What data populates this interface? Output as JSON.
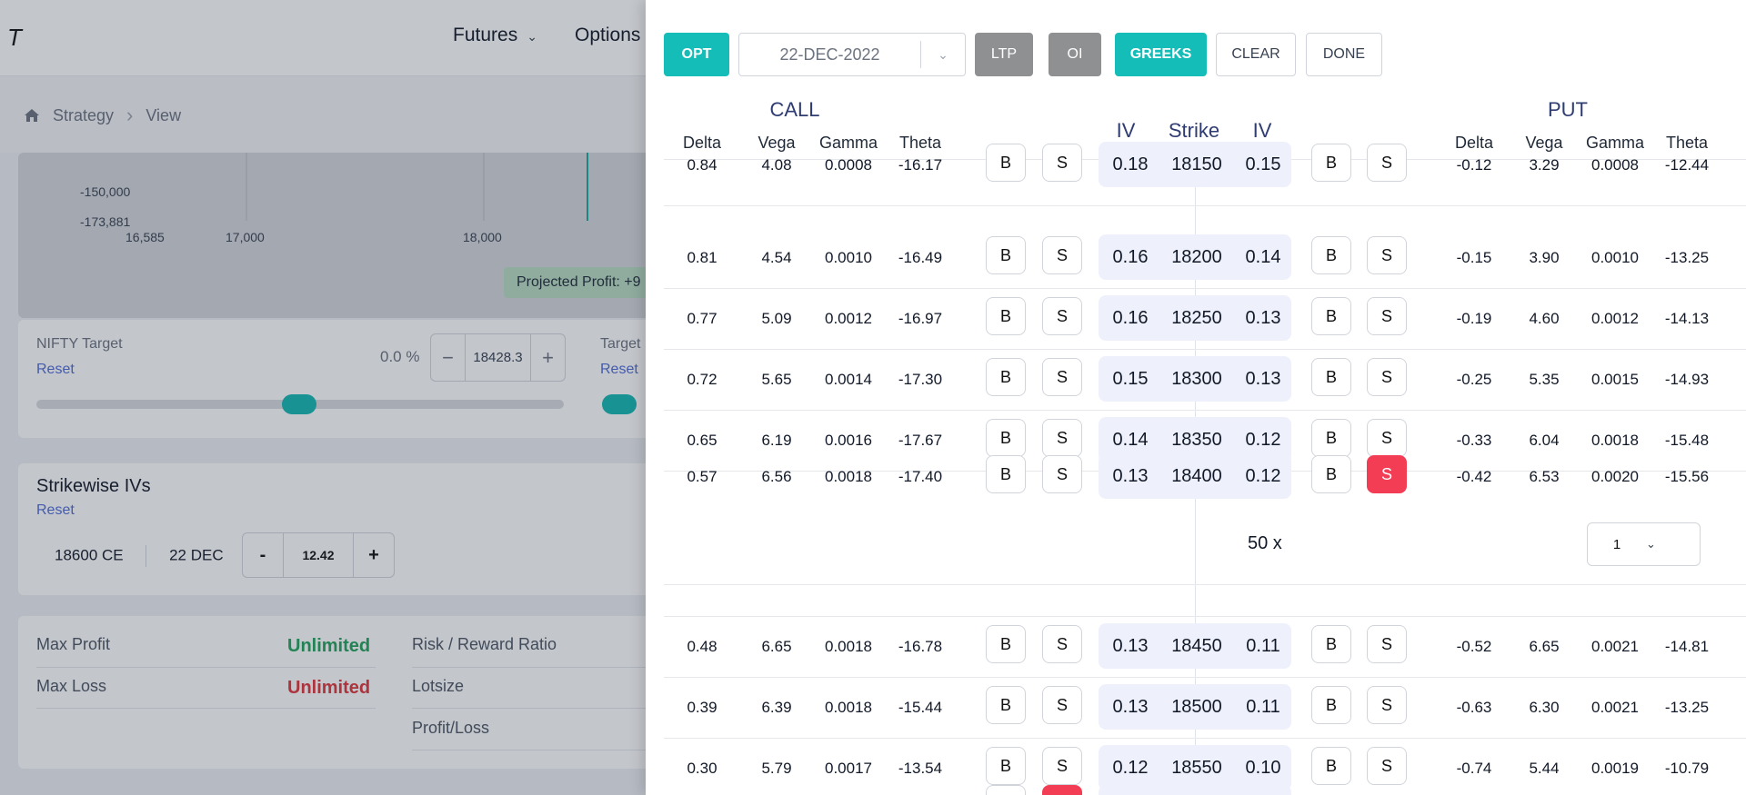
{
  "app": {
    "logo": "T"
  },
  "nav": {
    "futures": "Futures",
    "options": "Options"
  },
  "breadcrumb": {
    "home": "Strategy",
    "current": "View"
  },
  "payoff_chart": {
    "y_labels": [
      "-150,000",
      "-173,881"
    ],
    "x_labels": [
      "16,585",
      "17,000",
      "18,000"
    ],
    "projected_profit": "Projected Profit:  +9"
  },
  "target": {
    "nifty_label": "NIFTY Target",
    "reset": "Reset",
    "percent": "0.0 %",
    "value": "18428.3",
    "target_label": "Target",
    "target_reset": "Reset"
  },
  "strikewise": {
    "title": "Strikewise IVs",
    "reset": "Reset",
    "instrument": "18600 CE",
    "expiry": "22 DEC",
    "minus": "-",
    "plus": "+",
    "iv_value": "12.42"
  },
  "summary": {
    "max_profit_label": "Max Profit",
    "max_profit_value": "Unlimited",
    "max_loss_label": "Max Loss",
    "max_loss_value": "Unlimited",
    "risk_reward_label": "Risk / Reward Ratio",
    "lotsize_label": "Lotsize",
    "profit_loss_label": "Profit/Loss",
    "profit_color": "#22a35a",
    "loss_color": "#e0353b"
  },
  "toolbar": {
    "opt": "OPT",
    "date": "22-DEC-2022",
    "ltp": "LTP",
    "oi": "OI",
    "greeks": "GREEKS",
    "clear": "CLEAR",
    "done": "DONE"
  },
  "headers": {
    "call": "CALL",
    "put": "PUT",
    "delta": "Delta",
    "vega": "Vega",
    "gamma": "Gamma",
    "theta": "Theta",
    "iv": "IV",
    "strike": "Strike"
  },
  "rows": [
    {
      "c_delta": "0.84",
      "c_vega": "4.08",
      "c_gamma": "0.0008",
      "c_theta": "-16.17",
      "c_iv": "0.18",
      "strike": "18150",
      "p_iv": "0.15",
      "p_delta": "-0.12",
      "p_vega": "3.29",
      "p_gamma": "0.0008",
      "p_theta": "-12.44"
    },
    {
      "c_delta": "0.81",
      "c_vega": "4.54",
      "c_gamma": "0.0010",
      "c_theta": "-16.49",
      "c_iv": "0.16",
      "strike": "18200",
      "p_iv": "0.14",
      "p_delta": "-0.15",
      "p_vega": "3.90",
      "p_gamma": "0.0010",
      "p_theta": "-13.25"
    },
    {
      "c_delta": "0.77",
      "c_vega": "5.09",
      "c_gamma": "0.0012",
      "c_theta": "-16.97",
      "c_iv": "0.16",
      "strike": "18250",
      "p_iv": "0.13",
      "p_delta": "-0.19",
      "p_vega": "4.60",
      "p_gamma": "0.0012",
      "p_theta": "-14.13"
    },
    {
      "c_delta": "0.72",
      "c_vega": "5.65",
      "c_gamma": "0.0014",
      "c_theta": "-17.30",
      "c_iv": "0.15",
      "strike": "18300",
      "p_iv": "0.13",
      "p_delta": "-0.25",
      "p_vega": "5.35",
      "p_gamma": "0.0015",
      "p_theta": "-14.93"
    },
    {
      "c_delta": "0.65",
      "c_vega": "6.19",
      "c_gamma": "0.0016",
      "c_theta": "-17.67",
      "c_iv": "0.14",
      "strike": "18350",
      "p_iv": "0.12",
      "p_delta": "-0.33",
      "p_vega": "6.04",
      "p_gamma": "0.0018",
      "p_theta": "-15.48"
    },
    {
      "c_delta": "0.57",
      "c_vega": "6.56",
      "c_gamma": "0.0018",
      "c_theta": "-17.40",
      "c_iv": "0.13",
      "strike": "18400",
      "p_iv": "0.12",
      "p_delta": "-0.42",
      "p_vega": "6.53",
      "p_gamma": "0.0020",
      "p_theta": "-15.56"
    },
    {
      "c_delta": "0.48",
      "c_vega": "6.65",
      "c_gamma": "0.0018",
      "c_theta": "-16.78",
      "c_iv": "0.13",
      "strike": "18450",
      "p_iv": "0.11",
      "p_delta": "-0.52",
      "p_vega": "6.65",
      "p_gamma": "0.0021",
      "p_theta": "-14.81"
    },
    {
      "c_delta": "0.39",
      "c_vega": "6.39",
      "c_gamma": "0.0018",
      "c_theta": "-15.44",
      "c_iv": "0.13",
      "strike": "18500",
      "p_iv": "0.11",
      "p_delta": "-0.63",
      "p_vega": "6.30",
      "p_gamma": "0.0021",
      "p_theta": "-13.25"
    },
    {
      "c_delta": "0.30",
      "c_vega": "5.79",
      "c_gamma": "0.0017",
      "c_theta": "-13.54",
      "c_iv": "0.12",
      "strike": "18550",
      "p_iv": "0.10",
      "p_delta": "-0.74",
      "p_vega": "5.44",
      "p_gamma": "0.0019",
      "p_theta": "-10.79"
    }
  ],
  "selected_order": {
    "lot_multiplier": "50 x",
    "quantity": "1"
  },
  "buttons": {
    "buy": "B",
    "sell": "S"
  },
  "colors": {
    "teal": "#14bdb7",
    "sell_active": "#f23d55",
    "header_blue": "#2f3c72"
  }
}
